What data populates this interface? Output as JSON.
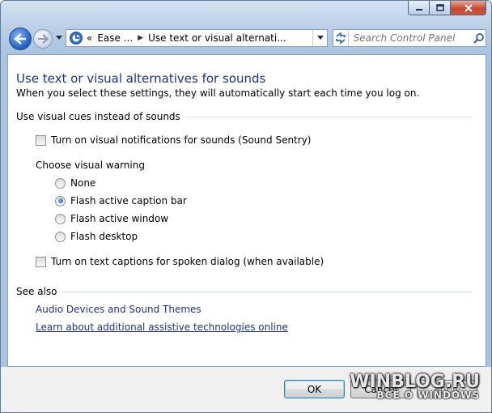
{
  "nav": {
    "breadcrumb_prefix": "«",
    "crumb_1": "Ease ...",
    "crumb_sep": "▶",
    "crumb_2": "Use text or visual alternati...",
    "search_placeholder": "Search Control Panel"
  },
  "page": {
    "title": "Use text or visual alternatives for sounds",
    "description": "When you select these settings, they will automatically start each time you log on."
  },
  "visual_cues": {
    "header": "Use visual cues instead of sounds",
    "sound_sentry": {
      "label": "Turn on visual notifications for sounds (Sound Sentry)",
      "checked": false
    },
    "warning_label": "Choose visual warning",
    "options": [
      {
        "label": "None",
        "selected": false
      },
      {
        "label": "Flash active caption bar",
        "selected": true
      },
      {
        "label": "Flash active window",
        "selected": false
      },
      {
        "label": "Flash desktop",
        "selected": false
      }
    ],
    "text_captions": {
      "label": "Turn on text captions for spoken dialog (when available)",
      "checked": false
    }
  },
  "see_also": {
    "header": "See also",
    "links": [
      "Audio Devices and Sound Themes",
      "Learn about additional assistive technologies online"
    ]
  },
  "buttons": {
    "ok": "OK",
    "cancel": "Cancel",
    "apply": "Apply"
  },
  "watermark": {
    "main": "WINBLOG.RU",
    "sub": "ВСЁ О WINDOWS"
  },
  "colors": {
    "link": "#1e3287",
    "title": "#1e3287",
    "frame": "#bcd1e8"
  }
}
